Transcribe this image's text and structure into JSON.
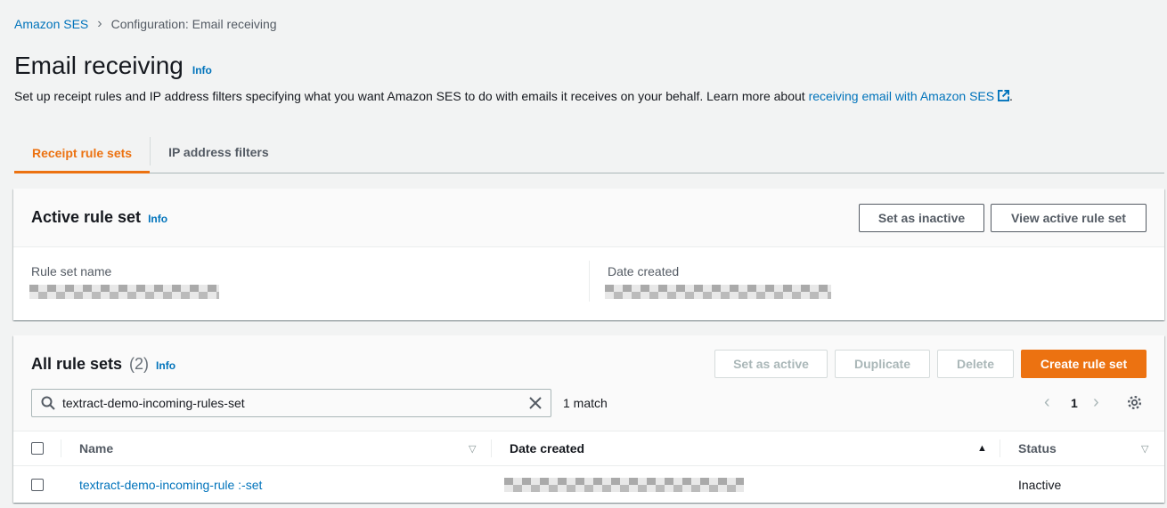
{
  "breadcrumb": {
    "root": "Amazon SES",
    "current": "Configuration: Email receiving"
  },
  "page": {
    "title": "Email receiving",
    "info": "Info",
    "description": "Set up receipt rules and IP address filters specifying what you want Amazon SES to do with emails it receives on your behalf. Learn more about ",
    "description_link": "receiving email with Amazon SES",
    "description_end": "."
  },
  "tabs": [
    {
      "label": "Receipt rule sets",
      "active": true
    },
    {
      "label": "IP address filters",
      "active": false
    }
  ],
  "active_rule_set": {
    "title": "Active rule set",
    "info": "Info",
    "set_inactive": "Set as inactive",
    "view_active": "View active rule set",
    "name_label": "Rule set name",
    "date_label": "Date created"
  },
  "all_rule_sets": {
    "title": "All rule sets",
    "count": "(2)",
    "info": "Info",
    "set_active": "Set as active",
    "duplicate": "Duplicate",
    "delete": "Delete",
    "create": "Create rule set",
    "search_value": "textract-demo-incoming-rules-set",
    "match": "1 match",
    "page": "1",
    "columns": [
      "Name",
      "Date created",
      "Status"
    ],
    "rows": [
      {
        "name": "textract-demo-incoming-rule :-set",
        "status": "Inactive"
      }
    ]
  },
  "colors": {
    "accent": "#ec7211",
    "link": "#0073bb"
  }
}
